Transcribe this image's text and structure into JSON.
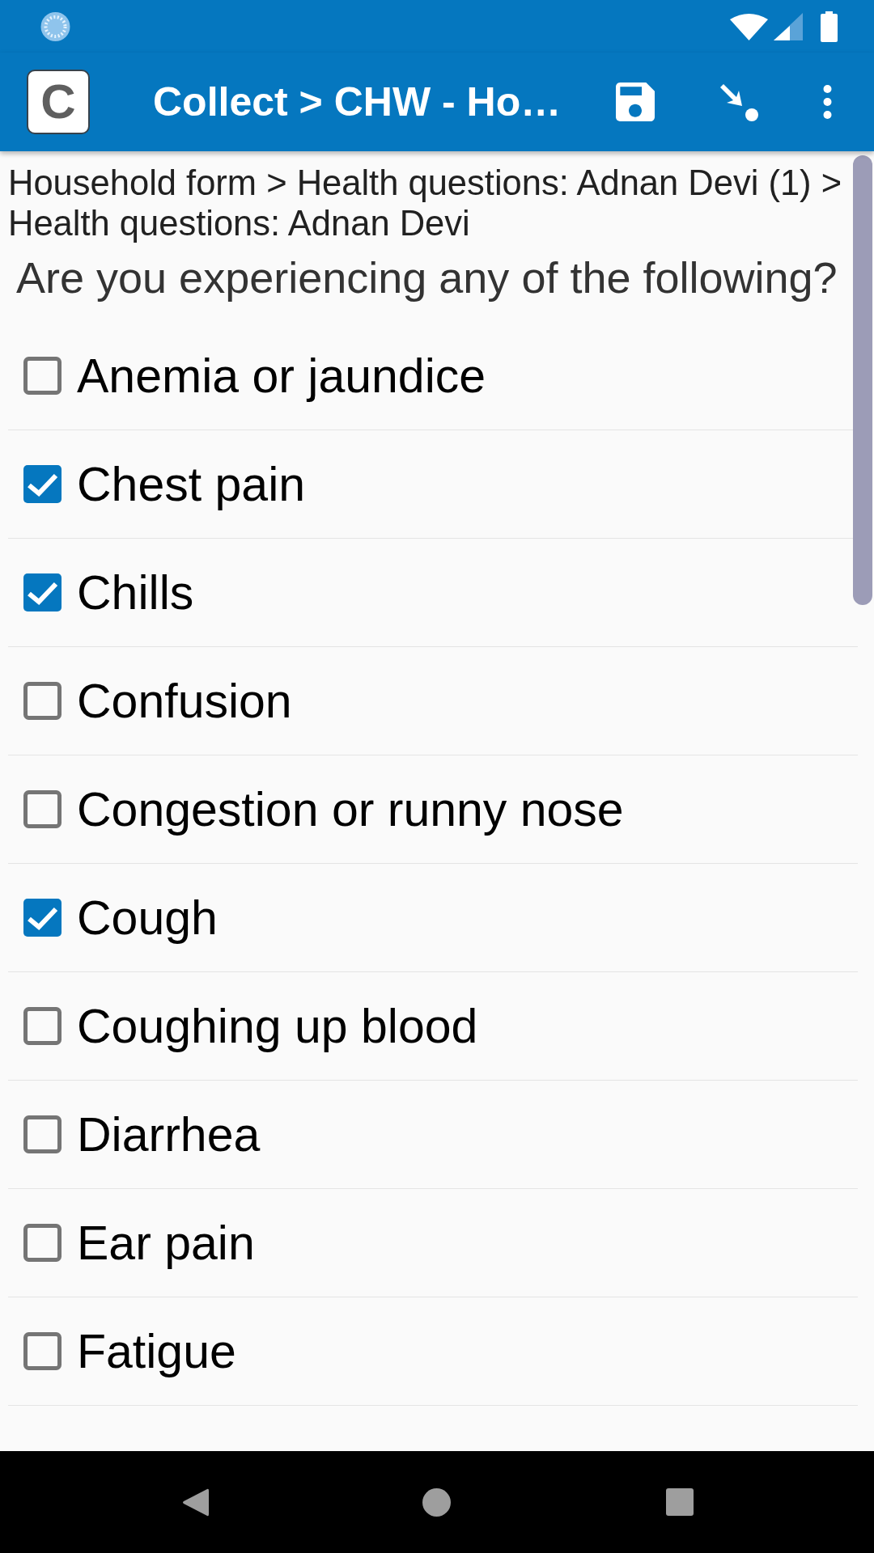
{
  "app_bar": {
    "logo_letter": "C",
    "title": "Collect > CHW - Ho…"
  },
  "breadcrumb": "Household form > Health questions: Adnan Devi (1) > Health questions: Adnan Devi",
  "question": {
    "text": "Are you experiencing any of the following?",
    "options": [
      {
        "label": "Anemia or jaundice",
        "checked": false
      },
      {
        "label": "Chest pain",
        "checked": true
      },
      {
        "label": "Chills",
        "checked": true
      },
      {
        "label": "Confusion",
        "checked": false
      },
      {
        "label": "Congestion or runny nose",
        "checked": false
      },
      {
        "label": "Cough",
        "checked": true
      },
      {
        "label": "Coughing up blood",
        "checked": false
      },
      {
        "label": "Diarrhea",
        "checked": false
      },
      {
        "label": "Ear pain",
        "checked": false
      },
      {
        "label": "Fatigue",
        "checked": false
      }
    ]
  }
}
